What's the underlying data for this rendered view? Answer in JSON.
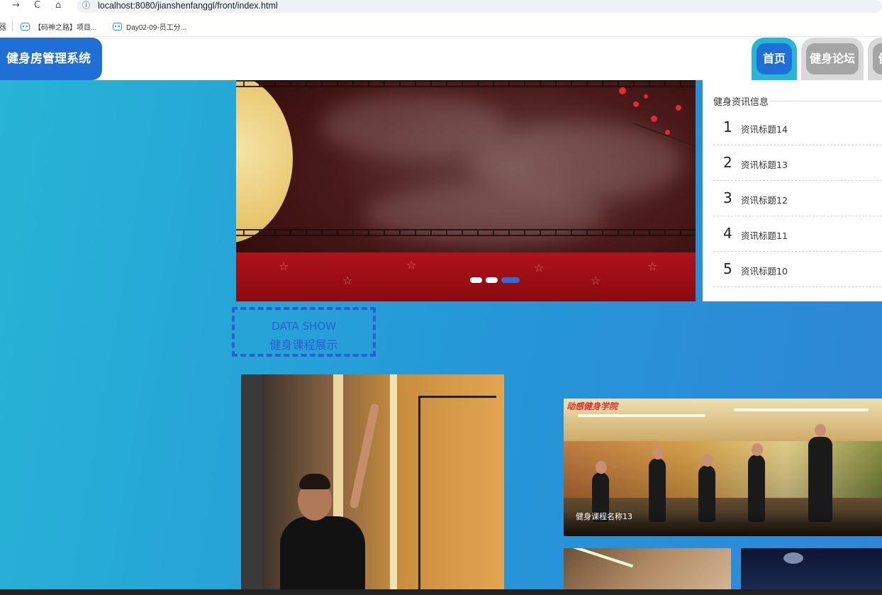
{
  "browser": {
    "back_glyph": "→",
    "reload_glyph": "C",
    "home_glyph": "⌂",
    "info_glyph": "ⓘ",
    "url": "localhost:8080/jianshenfanggl/front/index.html",
    "apps_glyph": "器",
    "bookmarks": [
      {
        "label": "【码神之路】项目..."
      },
      {
        "label": "Day02-09-员工分..."
      }
    ]
  },
  "header": {
    "site_title": "健身房管理系统",
    "nav": [
      {
        "label": "首页",
        "active": true
      },
      {
        "label": "健身论坛",
        "active": false
      },
      {
        "label": "健",
        "active": false
      }
    ]
  },
  "carousel": {
    "slide_count": 3,
    "active_index": 2
  },
  "news": {
    "heading": "健身资讯信息",
    "items": [
      {
        "num": "1",
        "title": "资讯标题14"
      },
      {
        "num": "2",
        "title": "资讯标题13"
      },
      {
        "num": "3",
        "title": "资讯标题12"
      },
      {
        "num": "4",
        "title": "资讯标题11"
      },
      {
        "num": "5",
        "title": "资讯标题10"
      }
    ]
  },
  "data_show": {
    "en": "DATA SHOW",
    "cn": "健身课程展示"
  },
  "courses": {
    "featured_caption": "健身课程名称13",
    "featured_brand": "动感健身学院"
  },
  "colors": {
    "primary": "#1f6fd6",
    "accent": "#29b6d3",
    "tab_inactive": "#a5a5a5"
  }
}
